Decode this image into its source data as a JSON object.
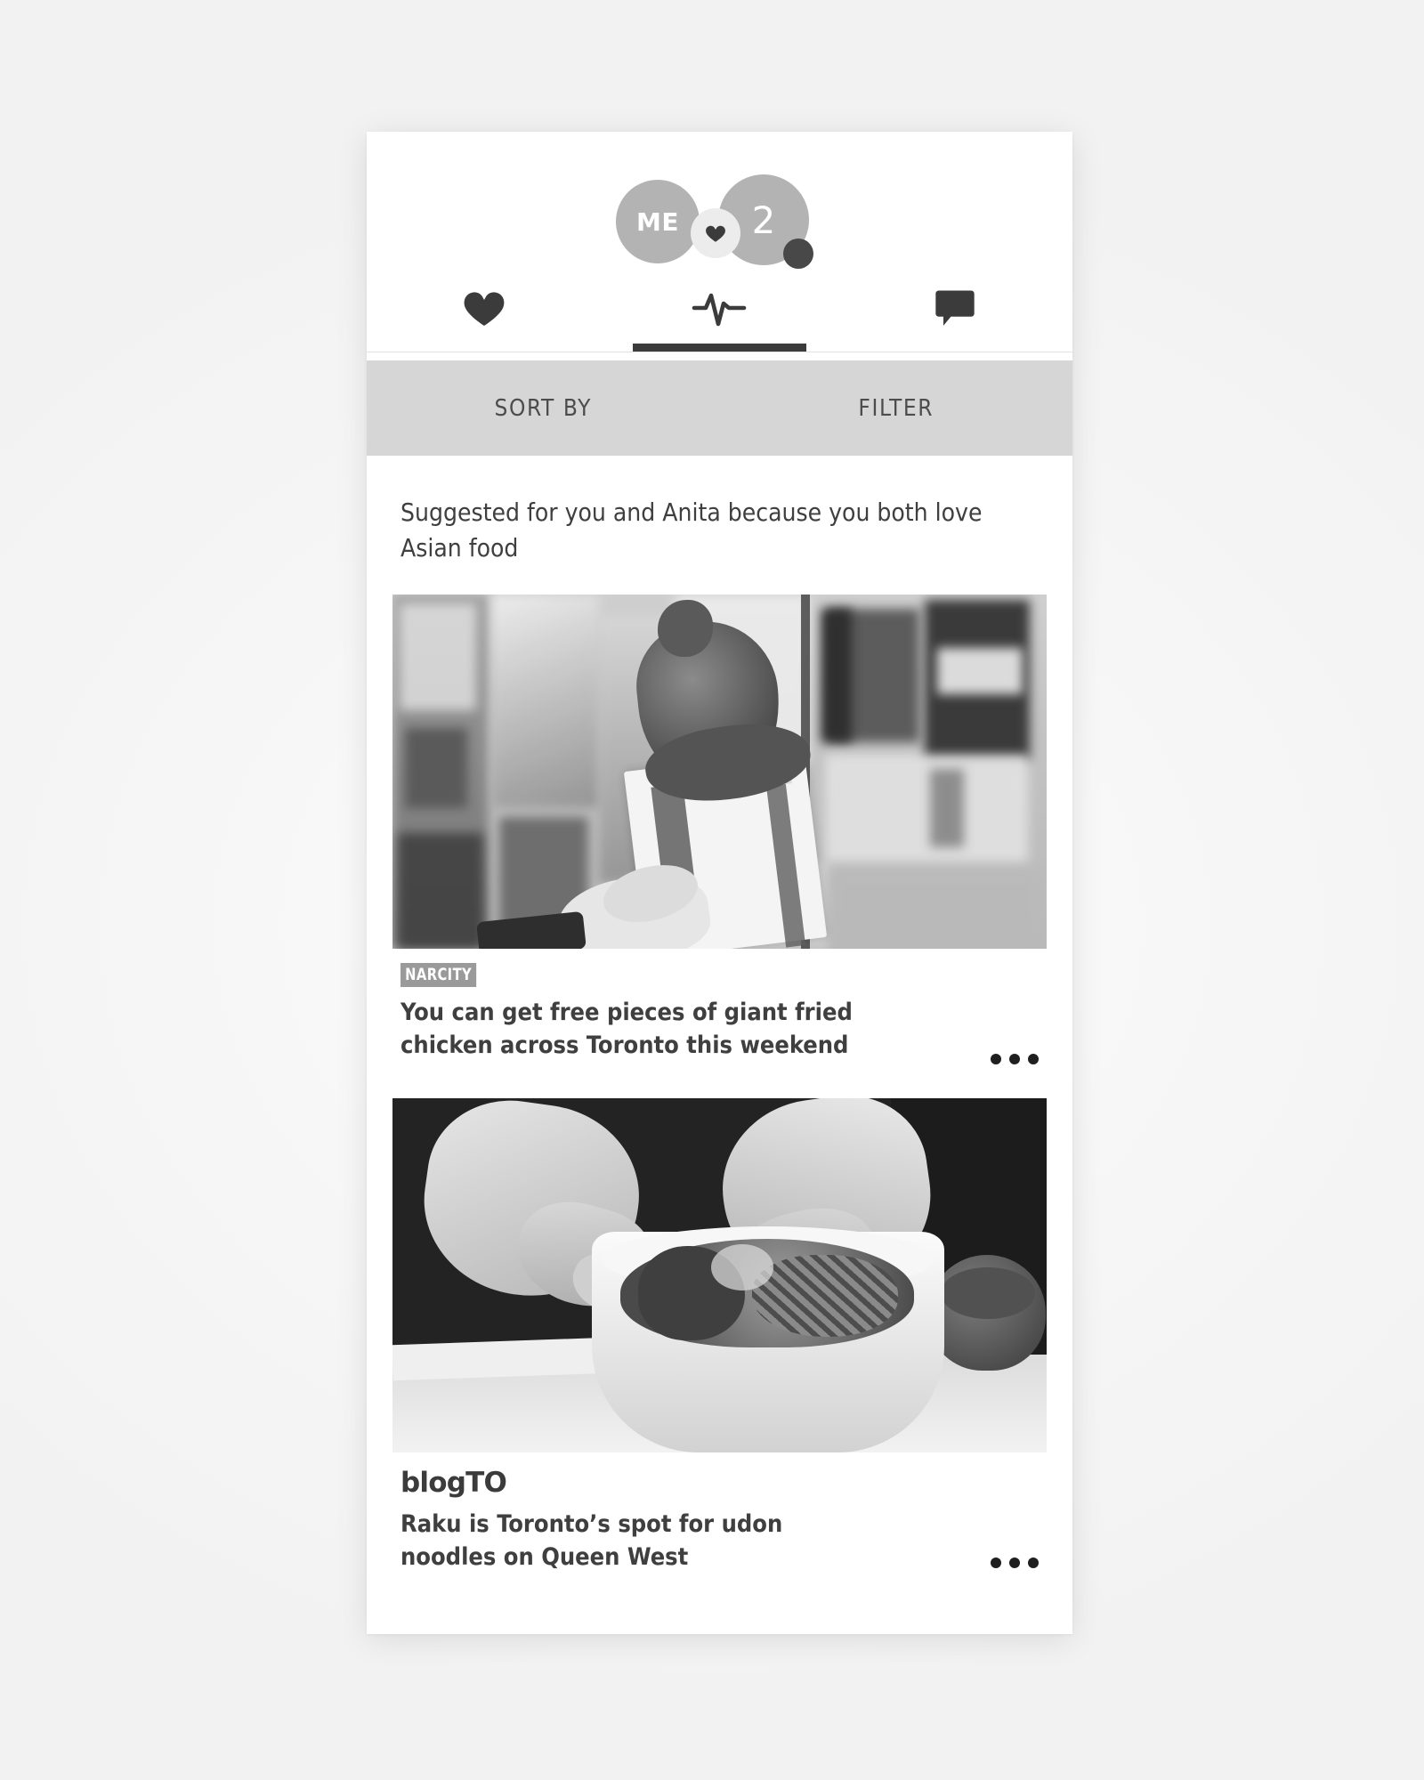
{
  "header": {
    "avatars": {
      "me_label": "ME",
      "count_label": "2",
      "heart_badge_icon": "heart-icon",
      "status_dot": ""
    },
    "tabs": [
      {
        "id": "likes",
        "icon": "heart-icon",
        "active": false
      },
      {
        "id": "activity",
        "icon": "pulse-icon",
        "active": true
      },
      {
        "id": "messages",
        "icon": "speech-bubble-icon",
        "active": false
      }
    ]
  },
  "toolbar": {
    "sort_label": "SORT BY",
    "filter_label": "FILTER"
  },
  "feed": {
    "suggestion_note": "Suggested for you and Anita because you both love Asian food",
    "cards": [
      {
        "source": "NARCITY",
        "source_style": "badge",
        "headline": "You can get free pieces of giant fried chicken across Toronto this weekend",
        "image_alt": "Hand holding giant fried chicken in a HOT-STAR bag on a city street",
        "more_icon": "ellipsis-icon"
      },
      {
        "source": "blogTO",
        "source_style": "wordmark",
        "headline": "Raku is Toronto’s spot for udon noodles on Queen West",
        "image_alt": "Hands garnishing a white bowl of udon noodles",
        "more_icon": "ellipsis-icon"
      }
    ]
  },
  "colors": {
    "avatar_gray": "#b3b3b3",
    "toolbar_gray": "#d6d6d6",
    "ink": "#3f3f3f",
    "accent_dark": "#3b3b3b",
    "badge_gray": "#9a9a9a"
  }
}
